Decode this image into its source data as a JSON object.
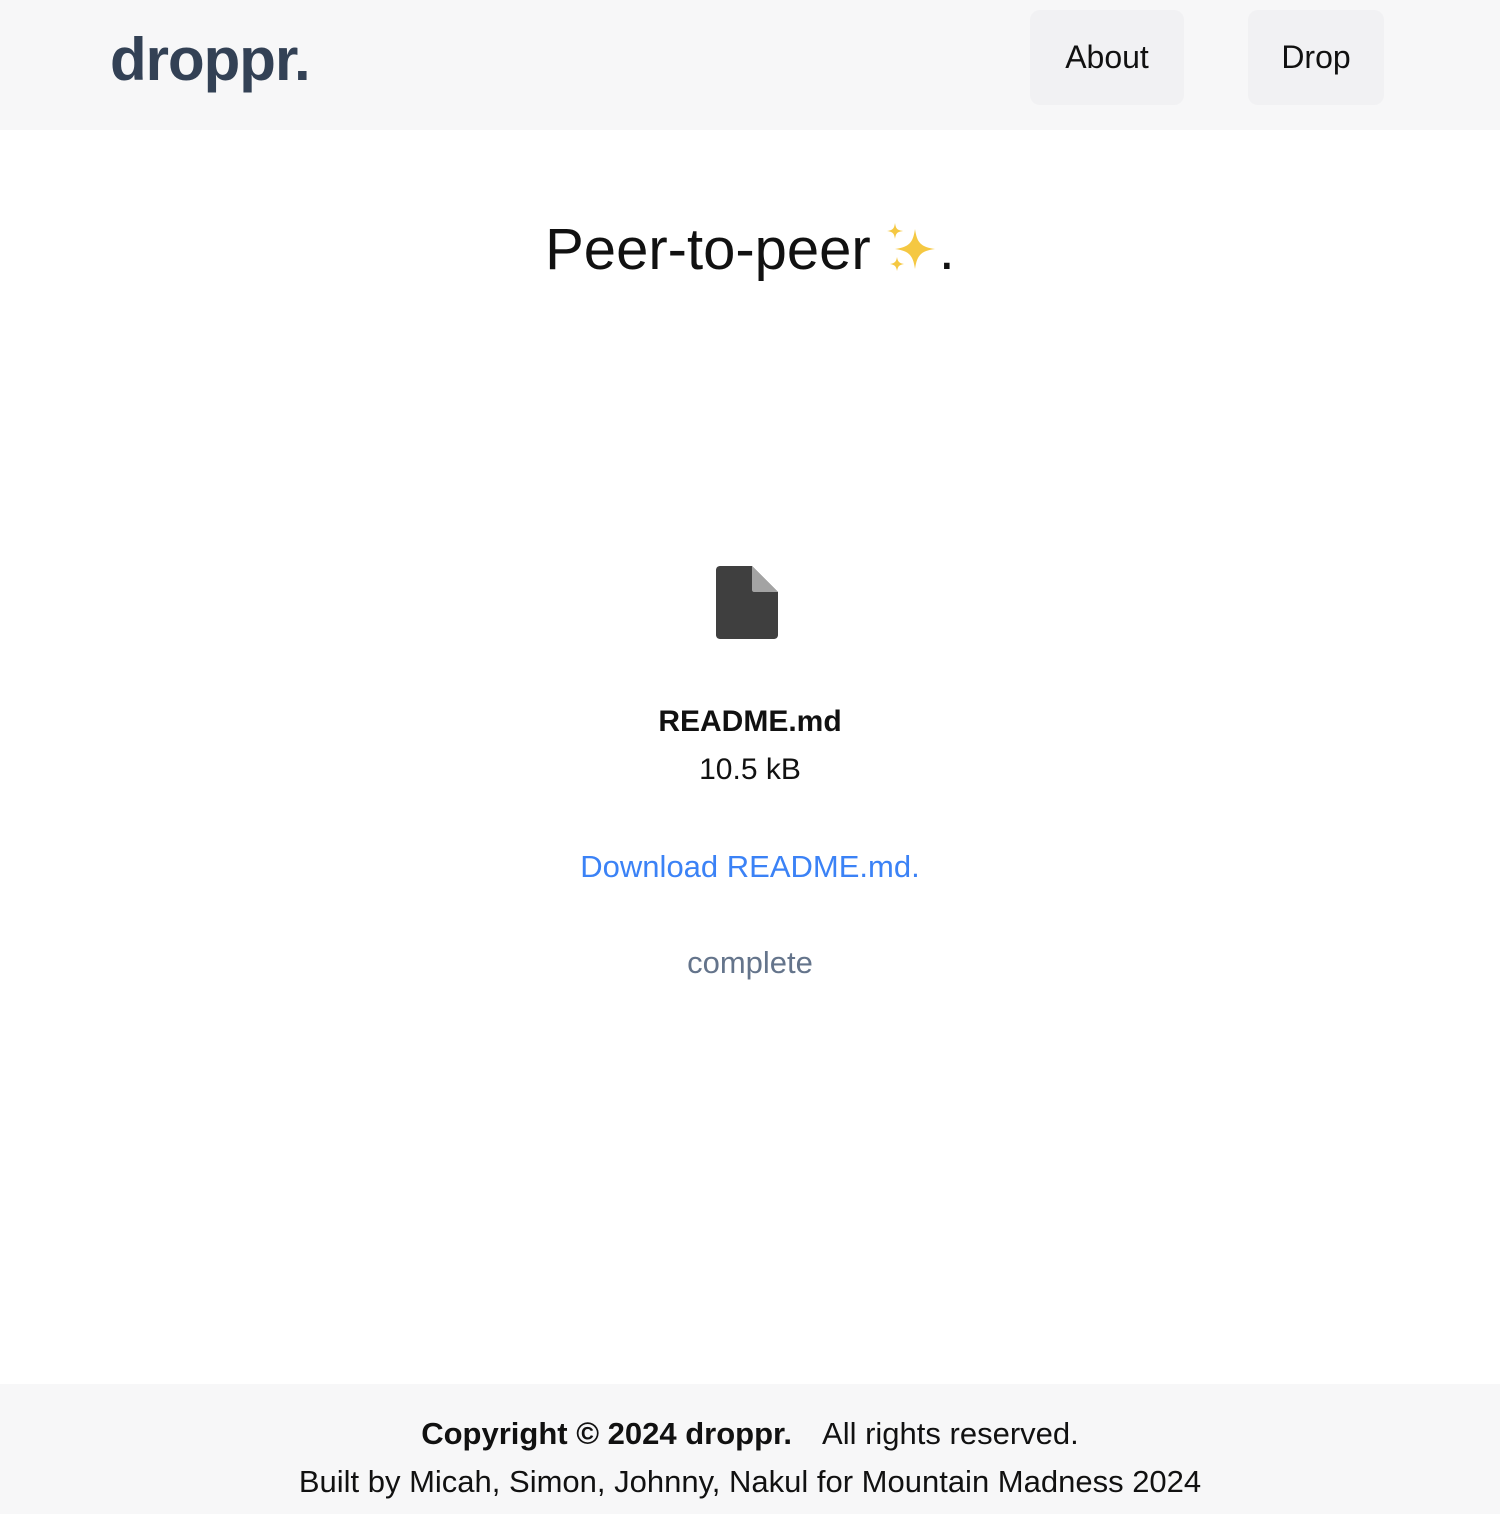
{
  "header": {
    "logo": "droppr.",
    "nav": [
      {
        "label": "About"
      },
      {
        "label": "Drop"
      }
    ]
  },
  "main": {
    "heading": "Peer-to-peer",
    "heading_emoji": "sparkles-icon",
    "heading_suffix": ".",
    "file": {
      "icon": "file-icon",
      "name": "README.md",
      "size": "10.5 kB"
    },
    "download_link": "Download README.md.",
    "status": "complete"
  },
  "footer": {
    "copyright": "Copyright © 2024 droppr.",
    "rights": "All rights reserved.",
    "credits": "Built by Micah, Simon, Johnny, Nakul for Mountain Madness 2024"
  },
  "colors": {
    "logo": "#334155",
    "header_bg": "#f7f7f8",
    "link": "#3b82f6",
    "status": "#64748b",
    "file_icon": "#3f3f3f",
    "sparkle": "#f5c842"
  }
}
